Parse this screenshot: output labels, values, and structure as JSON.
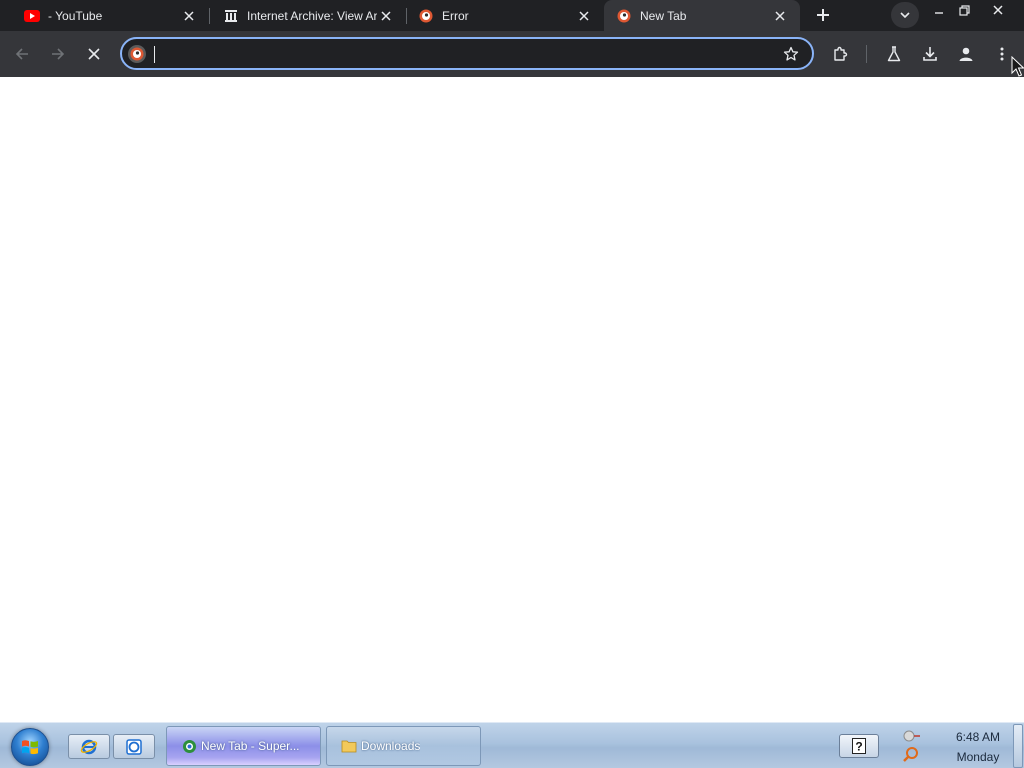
{
  "browser": {
    "tabs": [
      {
        "title": "- YouTube",
        "icon": "youtube-icon"
      },
      {
        "title": "Internet Archive: View Ar",
        "icon": "archive-icon"
      },
      {
        "title": "Error",
        "icon": "duckduckgo-icon"
      },
      {
        "title": "New Tab",
        "icon": "duckduckgo-icon",
        "active": true
      }
    ],
    "omnibox": {
      "value": "",
      "placeholder": ""
    },
    "colors": {
      "tabstrip": "#202124",
      "toolbar": "#35363a",
      "focus_ring": "#8ab4f8",
      "youtube_red": "#ff0000",
      "ddg_orange": "#de5833"
    }
  },
  "taskbar": {
    "tasks": [
      {
        "label": "New Tab - Super...",
        "icon": "browser-icon",
        "active": true
      },
      {
        "label": "Downloads",
        "icon": "folder-icon",
        "active": false
      }
    ],
    "help_label": "?",
    "clock": {
      "time": "6:48 AM",
      "day": "Monday"
    }
  }
}
